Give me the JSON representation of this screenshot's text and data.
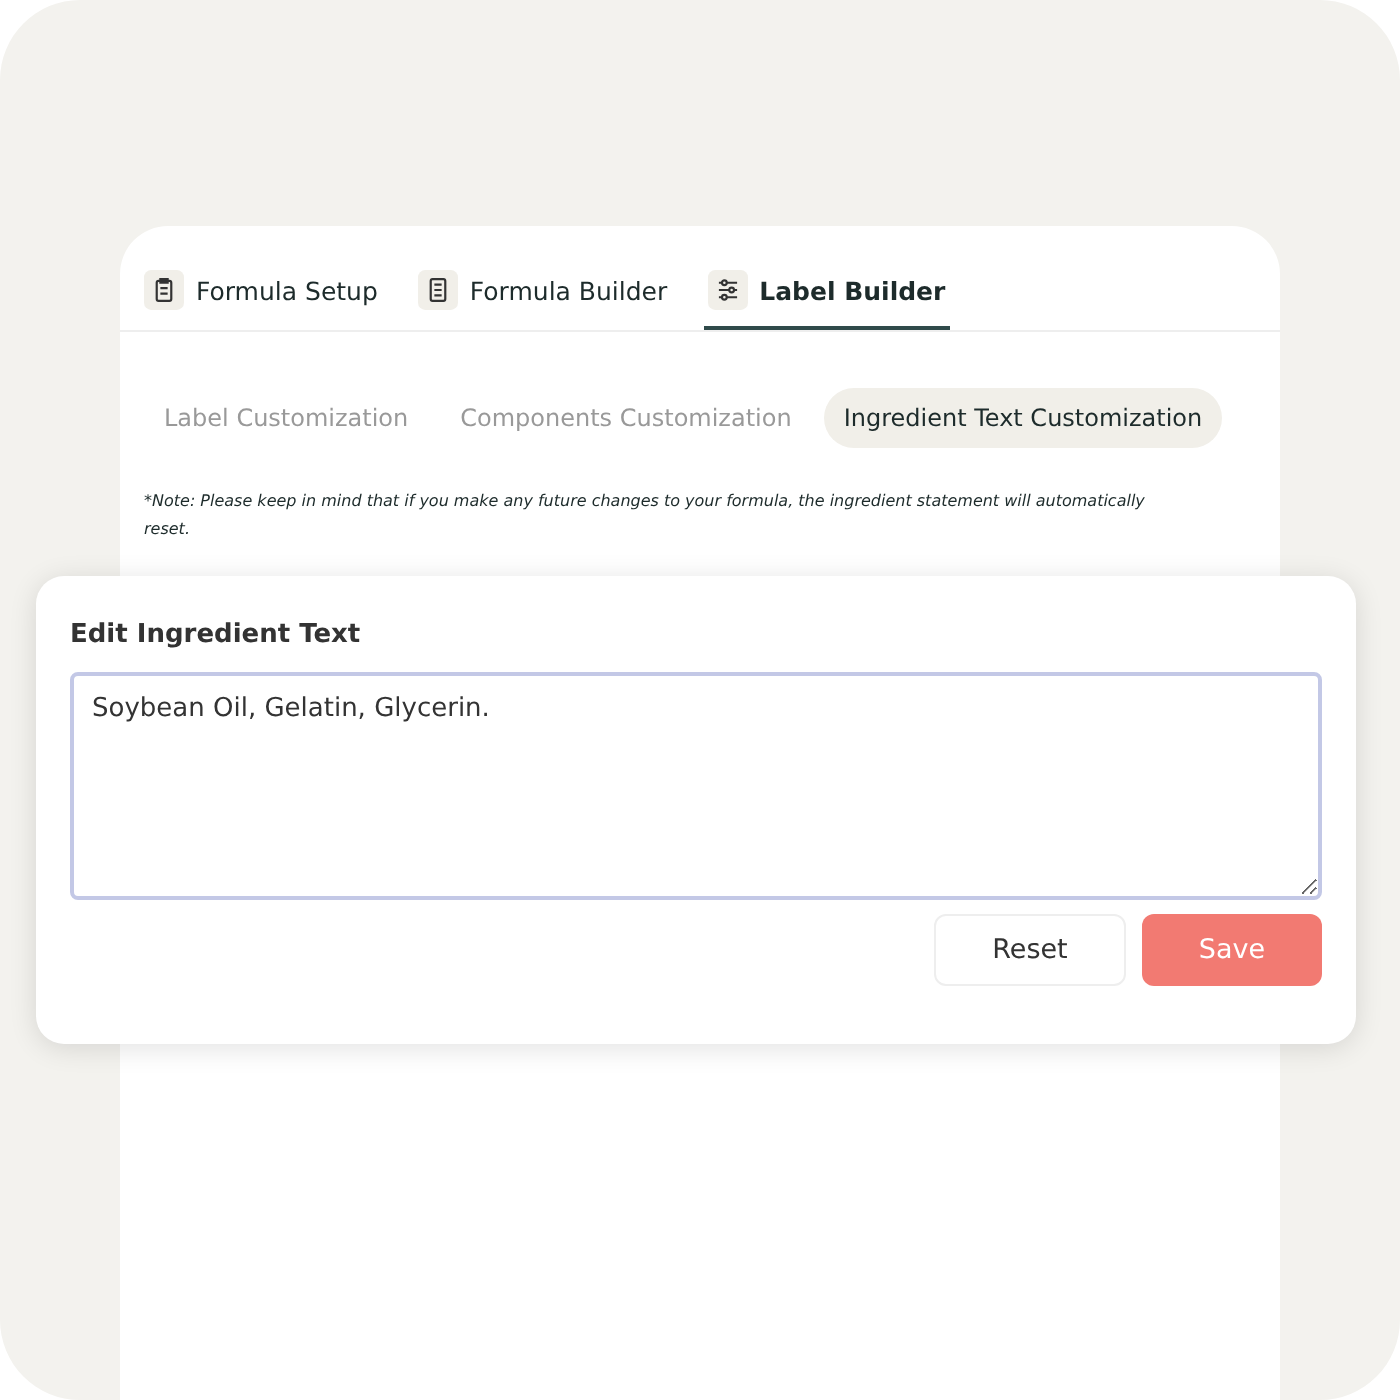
{
  "tabs": [
    {
      "label": "Formula Setup",
      "selected": false
    },
    {
      "label": "Formula Builder",
      "selected": false
    },
    {
      "label": "Label Builder",
      "selected": true
    }
  ],
  "subtabs": [
    {
      "label": "Label Customization",
      "selected": false
    },
    {
      "label": "Components Customization",
      "selected": false
    },
    {
      "label": "Ingredient Text Customization",
      "selected": true
    }
  ],
  "note": "*Note: Please keep in mind that if you make any future changes to your formula, the ingredient statement will automatically reset.",
  "editor": {
    "title": "Edit Ingredient Text",
    "value": "Soybean Oil, Gelatin, Glycerin."
  },
  "buttons": [
    {
      "label": "Reset",
      "kind": "secondary"
    },
    {
      "label": "Save",
      "kind": "primary"
    }
  ]
}
